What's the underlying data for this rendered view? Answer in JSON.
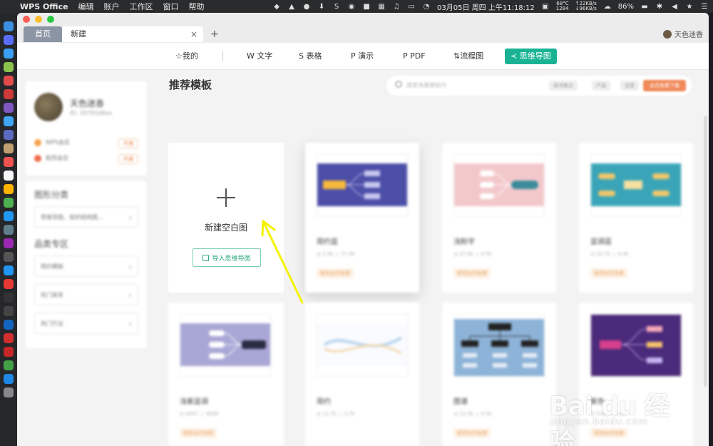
{
  "menubar": {
    "app_name": "WPS Office",
    "menus": [
      "编辑",
      "账户",
      "工作区",
      "窗口",
      "帮助"
    ],
    "clock": "03月05日 周四 上午11:18:12",
    "temp": "68°C",
    "rpm": "1284",
    "net_up": "↑22KB/s",
    "net_down": "↓96KB/s",
    "battery": "86%"
  },
  "tabs": {
    "home": "首页",
    "new": "新建",
    "close": "×",
    "add": "+"
  },
  "user_corner": {
    "name": "天色迷香"
  },
  "toolbar": {
    "mine": "☆我的",
    "text": "W 文字",
    "sheet": "S 表格",
    "present": "P 演示",
    "pdf": "P PDF",
    "flow": "流程图",
    "mindmap": "思维导图"
  },
  "sidebar": {
    "username": "天色迷香",
    "user_id": "ID: 2079108xx",
    "members": [
      {
        "label": "WPS会员",
        "badge": "开通",
        "color": "#f5a24b"
      },
      {
        "label": "稻壳会员",
        "badge": "开通",
        "color": "#ee6a4a"
      }
    ],
    "category_heading": "图形分类",
    "category_row": "思维导图、组织结构图...",
    "featured_heading": "品类专区",
    "featured_rows": [
      "简约模板",
      "热门商务",
      "热门行业"
    ]
  },
  "main": {
    "section_title": "推荐模板",
    "search_placeholder": "搜索海量模板内",
    "search_tags": [
      "读书笔记",
      "产品",
      "运营"
    ],
    "search_cta": "会员免费下载",
    "new_blank_label": "新建空白图",
    "import_label": "导入思维导图",
    "cards": [
      {
        "title": "简约蓝",
        "meta": "◎ 2.8k   ⊥ 77.4k",
        "tag": "稻壳会员免费"
      },
      {
        "title": "浅粉字",
        "meta": "◎ 27.6k   ⊥ 4.5k",
        "tag": "稻壳会员免费"
      },
      {
        "title": "蓝调蓝",
        "meta": "◎ 10.7k   ⊥ 4.4k",
        "tag": "稻壳会员免费"
      },
      {
        "title": "浅紫蓝调",
        "meta": "◎ 4447   ⊥ 4838",
        "tag": "稻壳会员免费"
      },
      {
        "title": "简约",
        "meta": "◎ 11.7k   ⊥ 3.7k",
        "tag": ""
      },
      {
        "title": "图谱",
        "meta": "◎ 13.3k   ⊥ 4.5k",
        "tag": "稻壳会员免费"
      },
      {
        "title": "紫色",
        "meta": "◎ 5.6k   ⊥ 3.2k",
        "tag": "稻壳会员免费"
      }
    ]
  },
  "watermark": {
    "brand": "Bai du 经验",
    "url": "jingyan.baidu.com"
  },
  "colors": {
    "accent": "#19b394",
    "card1_bg": "#4c4ea8",
    "card2_bg": "#f3c8cb",
    "card3_bg": "#3aa5b8",
    "card4_bg": "#a9a7d6",
    "card6_bg": "#8db3d8",
    "card7_bg": "#4a2a7a",
    "arrow": "#f3f200"
  }
}
